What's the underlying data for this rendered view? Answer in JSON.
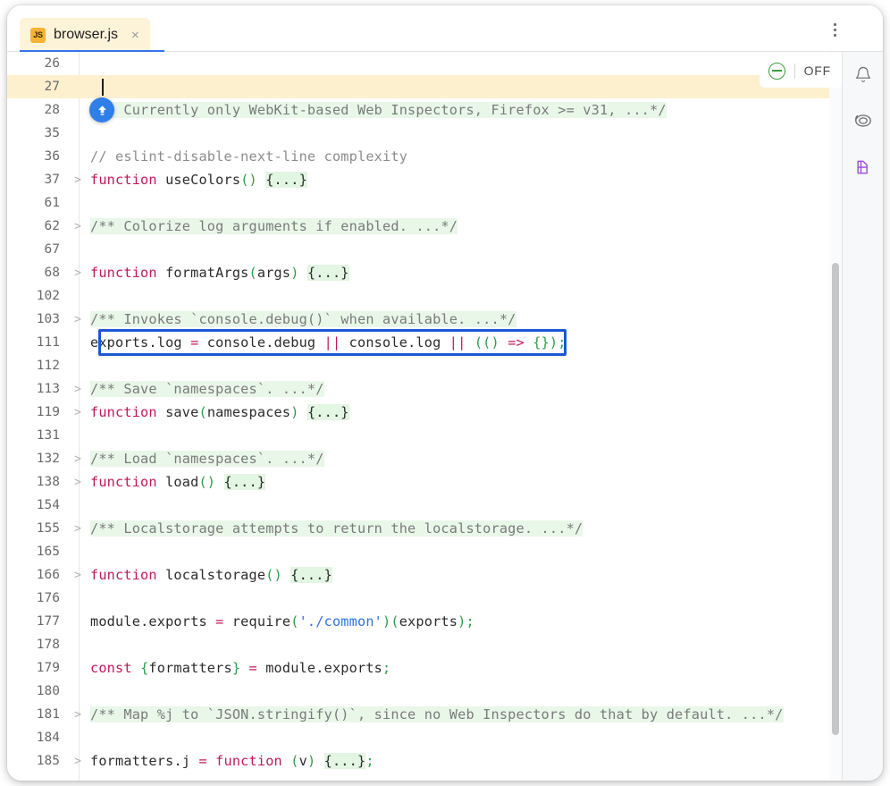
{
  "window": {
    "tab": {
      "filetype_badge": "JS",
      "title": "browser.js",
      "close_glyph": "×"
    },
    "kebab_menu_name": "more-options"
  },
  "inspection_widget": {
    "status_icon": "inspection-no-problems-icon",
    "label": "OFF"
  },
  "right_sidebar": {
    "items": [
      {
        "icon": "notifications-bell-icon"
      },
      {
        "icon": "ai-assistant-icon"
      },
      {
        "icon": "database-icon"
      }
    ]
  },
  "editor": {
    "caret_line": 27,
    "selected_line": 111,
    "scroll_thumb_top_pct": 29,
    "lines": [
      {
        "n": "26",
        "fold": "",
        "tokens": []
      },
      {
        "n": "27",
        "fold": "",
        "current": true,
        "tokens": []
      },
      {
        "n": "28",
        "fold": "",
        "action": "commit-push-button",
        "tokens": [
          {
            "c": "t-doc",
            "t": "/** Currently only WebKit-based Web Inspectors, Firefox >= v31, ...*/"
          }
        ]
      },
      {
        "n": "35",
        "fold": "",
        "tokens": []
      },
      {
        "n": "36",
        "fold": "",
        "tokens": [
          {
            "c": "t-cmt",
            "t": "// eslint-disable-next-line complexity"
          }
        ]
      },
      {
        "n": "37",
        "fold": ">",
        "tokens": [
          {
            "c": "t-kw",
            "t": "function"
          },
          {
            "c": "t-plain",
            "t": " useColors"
          },
          {
            "c": "t-par",
            "t": "()"
          },
          {
            "c": "t-plain",
            "t": " "
          },
          {
            "c": "t-fold",
            "t": "{...}"
          }
        ]
      },
      {
        "n": "61",
        "fold": "",
        "tokens": []
      },
      {
        "n": "62",
        "fold": ">",
        "tokens": [
          {
            "c": "t-doc",
            "t": "/** Colorize log arguments if enabled. ...*/"
          }
        ]
      },
      {
        "n": "67",
        "fold": "",
        "tokens": []
      },
      {
        "n": "68",
        "fold": ">",
        "tokens": [
          {
            "c": "t-kw",
            "t": "function"
          },
          {
            "c": "t-plain",
            "t": " formatArgs"
          },
          {
            "c": "t-par",
            "t": "("
          },
          {
            "c": "t-plain",
            "t": "args"
          },
          {
            "c": "t-par",
            "t": ")"
          },
          {
            "c": "t-plain",
            "t": " "
          },
          {
            "c": "t-fold",
            "t": "{...}"
          }
        ]
      },
      {
        "n": "102",
        "fold": "",
        "tokens": []
      },
      {
        "n": "103",
        "fold": ">",
        "tokens": [
          {
            "c": "t-doc",
            "t": "/** Invokes `console.debug()` when available. ...*/"
          }
        ]
      },
      {
        "n": "111",
        "fold": "",
        "selected": true,
        "tokens": [
          {
            "c": "t-plain",
            "t": "exports"
          },
          {
            "c": "t-plain",
            "t": "."
          },
          {
            "c": "t-plain",
            "t": "log "
          },
          {
            "c": "t-op",
            "t": "="
          },
          {
            "c": "t-plain",
            "t": " console"
          },
          {
            "c": "t-plain",
            "t": "."
          },
          {
            "c": "t-plain",
            "t": "debug "
          },
          {
            "c": "t-op",
            "t": "||"
          },
          {
            "c": "t-plain",
            "t": " console"
          },
          {
            "c": "t-plain",
            "t": "."
          },
          {
            "c": "t-plain",
            "t": "log "
          },
          {
            "c": "t-op",
            "t": "||"
          },
          {
            "c": "t-plain",
            "t": " "
          },
          {
            "c": "t-par",
            "t": "(()"
          },
          {
            "c": "t-plain",
            "t": " "
          },
          {
            "c": "t-op",
            "t": "=>"
          },
          {
            "c": "t-plain",
            "t": " "
          },
          {
            "c": "t-par",
            "t": "{});"
          }
        ]
      },
      {
        "n": "112",
        "fold": "",
        "tokens": []
      },
      {
        "n": "113",
        "fold": ">",
        "tokens": [
          {
            "c": "t-doc",
            "t": "/** Save `namespaces`. ...*/"
          }
        ]
      },
      {
        "n": "119",
        "fold": ">",
        "tokens": [
          {
            "c": "t-kw",
            "t": "function"
          },
          {
            "c": "t-plain",
            "t": " save"
          },
          {
            "c": "t-par",
            "t": "("
          },
          {
            "c": "t-plain",
            "t": "namespaces"
          },
          {
            "c": "t-par",
            "t": ")"
          },
          {
            "c": "t-plain",
            "t": " "
          },
          {
            "c": "t-fold",
            "t": "{...}"
          }
        ]
      },
      {
        "n": "131",
        "fold": "",
        "tokens": []
      },
      {
        "n": "132",
        "fold": ">",
        "tokens": [
          {
            "c": "t-doc",
            "t": "/** Load `namespaces`. ...*/"
          }
        ]
      },
      {
        "n": "138",
        "fold": ">",
        "tokens": [
          {
            "c": "t-kw",
            "t": "function"
          },
          {
            "c": "t-plain",
            "t": " load"
          },
          {
            "c": "t-par",
            "t": "()"
          },
          {
            "c": "t-plain",
            "t": " "
          },
          {
            "c": "t-fold",
            "t": "{...}"
          }
        ]
      },
      {
        "n": "154",
        "fold": "",
        "tokens": []
      },
      {
        "n": "155",
        "fold": ">",
        "tokens": [
          {
            "c": "t-doc",
            "t": "/** Localstorage attempts to return the localstorage. ...*/"
          }
        ]
      },
      {
        "n": "165",
        "fold": "",
        "tokens": []
      },
      {
        "n": "166",
        "fold": ">",
        "tokens": [
          {
            "c": "t-kw",
            "t": "function"
          },
          {
            "c": "t-plain",
            "t": " localstorage"
          },
          {
            "c": "t-par",
            "t": "()"
          },
          {
            "c": "t-plain",
            "t": " "
          },
          {
            "c": "t-fold",
            "t": "{...}"
          }
        ]
      },
      {
        "n": "176",
        "fold": "",
        "tokens": []
      },
      {
        "n": "177",
        "fold": "",
        "tokens": [
          {
            "c": "t-plain",
            "t": "module"
          },
          {
            "c": "t-plain",
            "t": "."
          },
          {
            "c": "t-plain",
            "t": "exports "
          },
          {
            "c": "t-op",
            "t": "="
          },
          {
            "c": "t-plain",
            "t": " require"
          },
          {
            "c": "t-par",
            "t": "("
          },
          {
            "c": "t-str",
            "t": "'./common'"
          },
          {
            "c": "t-par",
            "t": ")("
          },
          {
            "c": "t-plain",
            "t": "exports"
          },
          {
            "c": "t-par",
            "t": ");"
          }
        ]
      },
      {
        "n": "178",
        "fold": "",
        "tokens": []
      },
      {
        "n": "179",
        "fold": "",
        "tokens": [
          {
            "c": "t-kw",
            "t": "const"
          },
          {
            "c": "t-plain",
            "t": " "
          },
          {
            "c": "t-par",
            "t": "{"
          },
          {
            "c": "t-plain",
            "t": "formatters"
          },
          {
            "c": "t-par",
            "t": "}"
          },
          {
            "c": "t-plain",
            "t": " "
          },
          {
            "c": "t-op",
            "t": "="
          },
          {
            "c": "t-plain",
            "t": " module"
          },
          {
            "c": "t-plain",
            "t": "."
          },
          {
            "c": "t-plain",
            "t": "exports"
          },
          {
            "c": "t-par",
            "t": ";"
          }
        ]
      },
      {
        "n": "180",
        "fold": "",
        "tokens": []
      },
      {
        "n": "181",
        "fold": ">",
        "tokens": [
          {
            "c": "t-doc",
            "t": "/** Map %j to `JSON.stringify()`, since no Web Inspectors do that by default. ...*/"
          }
        ]
      },
      {
        "n": "184",
        "fold": "",
        "tokens": []
      },
      {
        "n": "185",
        "fold": ">",
        "clipped": true,
        "tokens": [
          {
            "c": "t-plain",
            "t": "formatters"
          },
          {
            "c": "t-plain",
            "t": ".j "
          },
          {
            "c": "t-op",
            "t": "="
          },
          {
            "c": "t-plain",
            "t": " "
          },
          {
            "c": "t-kw",
            "t": "function"
          },
          {
            "c": "t-plain",
            "t": " "
          },
          {
            "c": "t-par",
            "t": "("
          },
          {
            "c": "t-plain",
            "t": "v"
          },
          {
            "c": "t-par",
            "t": ")"
          },
          {
            "c": "t-plain",
            "t": " "
          },
          {
            "c": "t-fold",
            "t": "{...}"
          },
          {
            "c": "t-par",
            "t": ";"
          }
        ]
      }
    ]
  },
  "colors": {
    "tab_background": "#fdf3d8",
    "tab_underline": "#3574f0",
    "keyword": "#c2185b",
    "string": "#2f71e0",
    "paren": "#2e9e49",
    "doc_comment_bg": "#e9f7e9",
    "selection_border": "#1a57d6",
    "current_line_bg": "#fcf0cf",
    "action_button": "#2f7fe8",
    "inspection_ok": "#3a9c3a"
  }
}
